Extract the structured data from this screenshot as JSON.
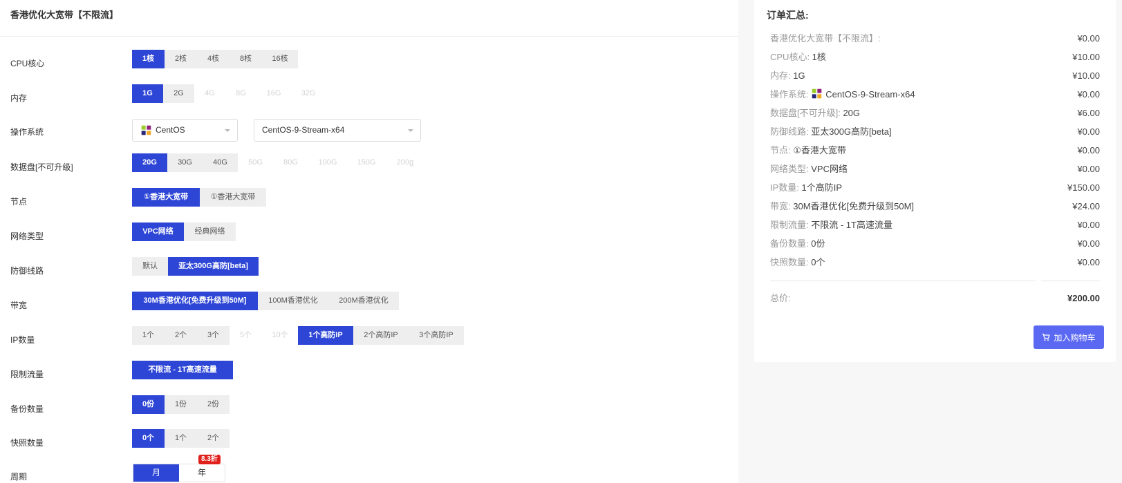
{
  "product_title": "香港优化大宽带【不限流】",
  "config": {
    "cpu": {
      "label": "CPU核心",
      "options": [
        "1核",
        "2核",
        "4核",
        "8核",
        "16核"
      ]
    },
    "memory": {
      "label": "内存",
      "options": [
        "1G",
        "2G",
        "4G",
        "8G",
        "16G",
        "32G"
      ]
    },
    "os": {
      "label": "操作系统",
      "family": "CentOS",
      "version": "CentOS-9-Stream-x64"
    },
    "disk": {
      "label": "数据盘[不可升级]",
      "options": [
        "20G",
        "30G",
        "40G",
        "50G",
        "80G",
        "100G",
        "150G",
        "200g"
      ]
    },
    "node": {
      "label": "节点",
      "options": [
        "①香港大宽带",
        "①香港大宽带"
      ]
    },
    "network": {
      "label": "网络类型",
      "options": [
        "VPC网络",
        "经典网络"
      ]
    },
    "defense": {
      "label": "防御线路",
      "options": [
        "默认",
        "亚太300G高防[beta]"
      ]
    },
    "bandwidth": {
      "label": "带宽",
      "options": [
        "30M香港优化[免费升级到50M]",
        "100M香港优化",
        "200M香港优化"
      ]
    },
    "ip": {
      "label": "IP数量",
      "options": [
        "1个",
        "2个",
        "3个",
        "5个",
        "10个",
        "1个高防IP",
        "2个高防IP",
        "3个高防IP"
      ]
    },
    "traffic": {
      "label": "限制流量",
      "options": [
        "不限流 - 1T高速流量"
      ]
    },
    "backup": {
      "label": "备份数量",
      "options": [
        "0份",
        "1份",
        "2份"
      ]
    },
    "snapshot": {
      "label": "快照数量",
      "options": [
        "0个",
        "1个",
        "2个"
      ]
    },
    "period": {
      "label": "周期",
      "options": [
        "月",
        "年"
      ],
      "discount": "8.3折"
    }
  },
  "summary": {
    "title": "订单汇总:",
    "items": [
      {
        "key": "香港优化大宽带【不限流】:",
        "value": "",
        "price": "¥0.00"
      },
      {
        "key": "CPU核心: ",
        "value": "1核",
        "price": "¥10.00"
      },
      {
        "key": "内存: ",
        "value": "1G",
        "price": "¥10.00"
      },
      {
        "key": "操作系统: ",
        "value": "CentOS-9-Stream-x64",
        "price": "¥0.00"
      },
      {
        "key": "数据盘[不可升级]: ",
        "value": "20G",
        "price": "¥6.00"
      },
      {
        "key": "防御线路: ",
        "value": "亚太300G高防[beta]",
        "price": "¥0.00"
      },
      {
        "key": "节点: ",
        "value": "①香港大宽带",
        "price": "¥0.00"
      },
      {
        "key": "网络类型: ",
        "value": "VPC网络",
        "price": "¥0.00"
      },
      {
        "key": "IP数量: ",
        "value": "1个高防IP",
        "price": "¥150.00"
      },
      {
        "key": "带宽: ",
        "value": "30M香港优化[免费升级到50M]",
        "price": "¥24.00"
      },
      {
        "key": "限制流量: ",
        "value": "不限流 - 1T高速流量",
        "price": "¥0.00"
      },
      {
        "key": "备份数量: ",
        "value": "0份",
        "price": "¥0.00"
      },
      {
        "key": "快照数量: ",
        "value": "0个",
        "price": "¥0.00"
      }
    ],
    "total_label": "总价:",
    "total_price": "¥200.00",
    "cart_button": "加入购物车"
  },
  "colors": {
    "selected": "#2e46d6",
    "option_bg": "#eeeeee",
    "cart_button": "#5b69f2",
    "discount_badge": "#e0201b"
  },
  "icons": {
    "os": "centos-logo-icon",
    "cart": "shopping-cart-icon",
    "dropdown": "chevron-down-icon"
  }
}
